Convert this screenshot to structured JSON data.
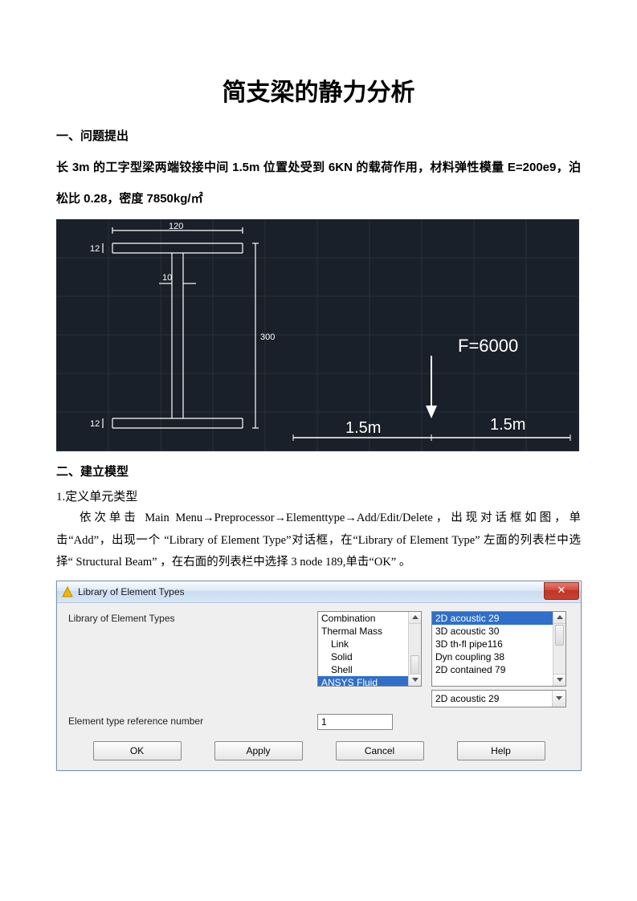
{
  "title": "简支梁的静力分析",
  "section1": {
    "heading": "一、问题提出",
    "para": "长 3m 的工字型梁两端铰接中间 1.5m 位置处受到 6KN 的载荷作用，材料弹性模量 E=200e9，泊松比 0.28，密度 7850kg/㎡"
  },
  "cad": {
    "dim_top": "120",
    "dim_flange_top": "12",
    "dim_web": "10",
    "dim_height": "300",
    "dim_flange_bot": "12",
    "force": "F=6000",
    "span_left": "1.5m",
    "span_right": "1.5m"
  },
  "section2": {
    "heading": "二、建立模型",
    "sub1": "1.定义单元类型",
    "para": "依次单击 Main Menu→Preprocessor→Elementtype→Add/Edit/Delete，出现对话框如图，单击“Add”，出现一个 “Library of Element Type”对话框，在“Library of Element Type” 左面的列表栏中选择“ Structural Beam” ，在右面的列表栏中选择 3 node 189,单击“OK” 。"
  },
  "dialog": {
    "title": "Library of Element Types",
    "label_lib": "Library of Element Types",
    "label_ref": "Element type reference number",
    "ref_value": "1",
    "left_list": [
      "Combination",
      "Thermal Mass",
      "Link",
      "Solid",
      "Shell",
      "ANSYS Fluid"
    ],
    "left_selected": "ANSYS Fluid",
    "right_list": [
      "2D acoustic   29",
      "3D acoustic   30",
      "3D th-fl pipe116",
      "Dyn coupling  38",
      "2D contained  79"
    ],
    "right_selected": "2D acoustic   29",
    "dropdown_value": "2D acoustic   29",
    "buttons": {
      "ok": "OK",
      "apply": "Apply",
      "cancel": "Cancel",
      "help": "Help"
    }
  }
}
